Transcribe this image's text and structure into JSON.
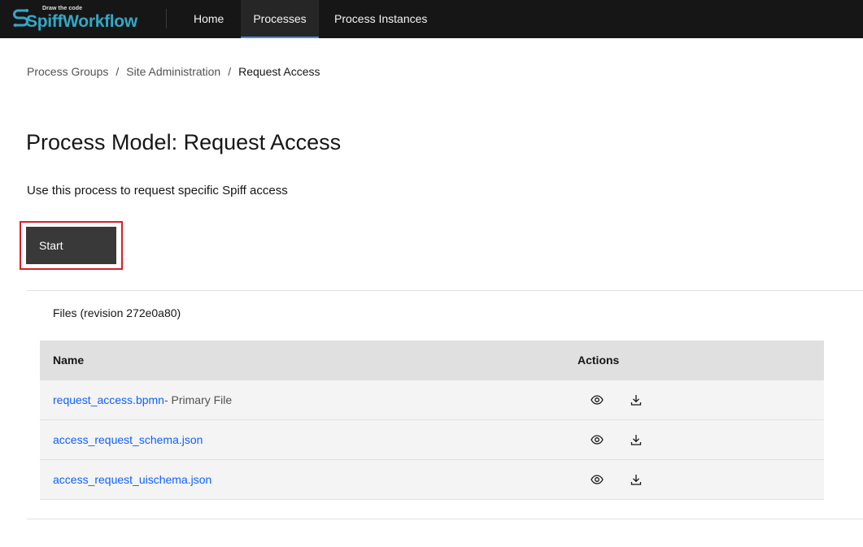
{
  "header": {
    "logo_tagline": "Draw the code",
    "logo_text": "SpiffWorkflow",
    "nav": [
      {
        "label": "Home",
        "active": false
      },
      {
        "label": "Processes",
        "active": true
      },
      {
        "label": "Process Instances",
        "active": false
      }
    ],
    "accent_color": "#4589ff"
  },
  "breadcrumb": {
    "items": [
      "Process Groups",
      "Site Administration"
    ],
    "separator": "/",
    "current": "Request Access"
  },
  "page": {
    "title": "Process Model: Request Access",
    "description": "Use this process to request specific Spiff access",
    "start_label": "Start",
    "highlight_color": "#da1e28"
  },
  "files": {
    "heading": "Files (revision 272e0a80)",
    "columns": [
      "Name",
      "Actions"
    ],
    "rows": [
      {
        "name": "request_access.bpmn",
        "suffix": "- Primary File",
        "actions": [
          "view-icon",
          "download-icon"
        ]
      },
      {
        "name": "access_request_schema.json",
        "suffix": "",
        "actions": [
          "view-icon",
          "download-icon"
        ]
      },
      {
        "name": "access_request_uischema.json",
        "suffix": "",
        "actions": [
          "view-icon",
          "download-icon"
        ]
      }
    ]
  }
}
